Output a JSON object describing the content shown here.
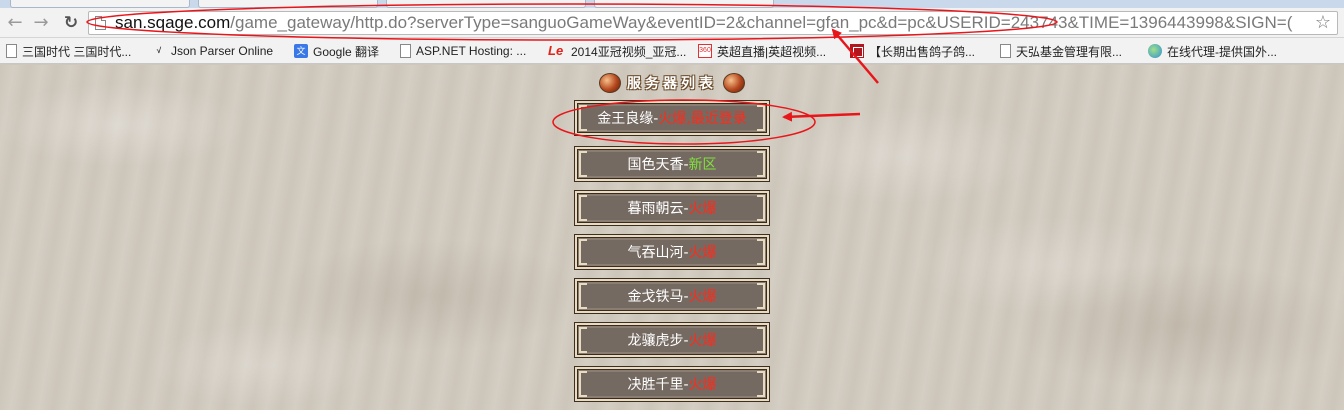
{
  "browser": {
    "url": {
      "host": "san.sqage.com",
      "path": "/game_gateway/http.do?serverType=sanguoGameWay&eventID=2&channel=gfan_pc&d=pc&USERID=243743&TIME=1396443998&SIGN=("
    },
    "icons": {
      "back": "←",
      "forward": "→",
      "reload": "↻",
      "star": "☆"
    }
  },
  "bookmarks": [
    {
      "label": "三国时代 三国时代...",
      "icon": "doc"
    },
    {
      "label": "Json Parser Online",
      "icon": "json"
    },
    {
      "label": "Google 翻译",
      "icon": "gtrans"
    },
    {
      "label": "ASP.NET Hosting: ...",
      "icon": "doc"
    },
    {
      "label": "2014亚冠视频_亚冠...",
      "icon": "le"
    },
    {
      "label": "英超直播|英超视频...",
      "icon": "s360"
    },
    {
      "label": "【长期出售鸽子鸽...",
      "icon": "red"
    },
    {
      "label": "天弘基金管理有限...",
      "icon": "doc"
    },
    {
      "label": "在线代理-提供国外...",
      "icon": "globe"
    }
  ],
  "page": {
    "title": "服务器列表",
    "servers": [
      {
        "name": "金王良缘-",
        "status": "火爆,最近登录",
        "status_type": "hot"
      },
      {
        "name": "国色天香-",
        "status": "新区",
        "status_type": "new"
      },
      {
        "name": "暮雨朝云-",
        "status": "火爆",
        "status_type": "hot"
      },
      {
        "name": "气吞山河-",
        "status": "火爆",
        "status_type": "hot"
      },
      {
        "name": "金戈铁马-",
        "status": "火爆",
        "status_type": "hot"
      },
      {
        "name": "龙骧虎步-",
        "status": "火爆",
        "status_type": "hot"
      },
      {
        "name": "决胜千里-",
        "status": "火爆",
        "status_type": "hot"
      }
    ]
  },
  "colors": {
    "hot": "#ff2a1a",
    "new": "#7fe23a",
    "annotation": "#e8161a"
  }
}
